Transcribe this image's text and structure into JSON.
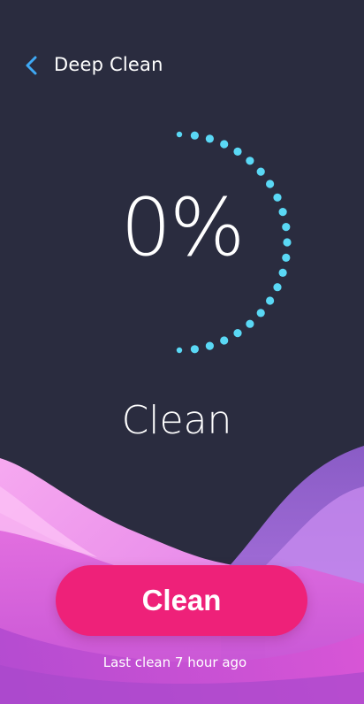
{
  "header": {
    "title": "Deep Clean",
    "back_icon": "chevron-left-icon"
  },
  "progress": {
    "percent_label": "0%",
    "value": 0,
    "status_label": "Clean"
  },
  "actions": {
    "clean_button_label": "Clean",
    "last_clean_text": "Last clean 7 hour ago"
  },
  "colors": {
    "background": "#2a2c3f",
    "accent_blue": "#3fa9f5",
    "dot_cyan": "#5ad8f5",
    "button_pink": "#ee2179",
    "wave_pink": "#f283e8",
    "wave_purple": "#9b5fd0",
    "wave_magenta": "#d04ad6"
  }
}
